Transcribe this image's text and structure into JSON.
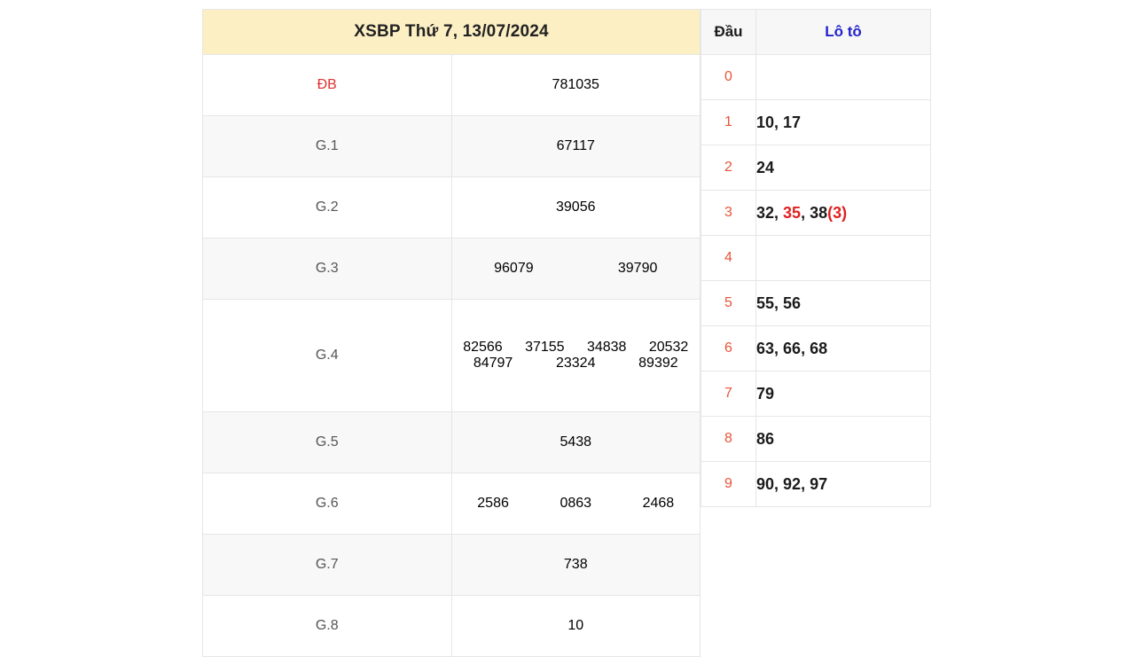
{
  "prize_table": {
    "title": "XSBP Thứ 7, 13/07/2024",
    "rows": [
      {
        "label": "ĐB",
        "special": true,
        "lines": [
          [
            "781035"
          ]
        ]
      },
      {
        "label": "G.1",
        "special": false,
        "lines": [
          [
            "67117"
          ]
        ]
      },
      {
        "label": "G.2",
        "special": false,
        "lines": [
          [
            "39056"
          ]
        ]
      },
      {
        "label": "G.3",
        "special": false,
        "lines": [
          [
            "96079",
            "39790"
          ]
        ]
      },
      {
        "label": "G.4",
        "special": false,
        "lines": [
          [
            "82566",
            "37155",
            "34838",
            "20532"
          ],
          [
            "84797",
            "23324",
            "89392"
          ]
        ]
      },
      {
        "label": "G.5",
        "special": false,
        "lines": [
          [
            "5438"
          ]
        ]
      },
      {
        "label": "G.6",
        "special": false,
        "lines": [
          [
            "2586",
            "0863",
            "2468"
          ]
        ]
      },
      {
        "label": "G.7",
        "special": false,
        "lines": [
          [
            "738"
          ]
        ]
      },
      {
        "label": "G.8",
        "special": false,
        "lines": [
          [
            "10"
          ]
        ]
      }
    ]
  },
  "loto_table": {
    "header": {
      "dau": "Đầu",
      "loto": "Lô tô"
    },
    "rows": [
      {
        "dau": "0",
        "numbers": []
      },
      {
        "dau": "1",
        "numbers": [
          {
            "text": "10",
            "highlight": false
          },
          {
            "text": "17",
            "highlight": false
          }
        ]
      },
      {
        "dau": "2",
        "numbers": [
          {
            "text": "24",
            "highlight": false
          }
        ]
      },
      {
        "dau": "3",
        "numbers": [
          {
            "text": "32",
            "highlight": false
          },
          {
            "text": "35",
            "highlight": true
          },
          {
            "text": "38(3)",
            "highlight": false,
            "suffix_highlight": "(3)"
          }
        ]
      },
      {
        "dau": "4",
        "numbers": []
      },
      {
        "dau": "5",
        "numbers": [
          {
            "text": "55",
            "highlight": false
          },
          {
            "text": "56",
            "highlight": false
          }
        ]
      },
      {
        "dau": "6",
        "numbers": [
          {
            "text": "63",
            "highlight": false
          },
          {
            "text": "66",
            "highlight": false
          },
          {
            "text": "68",
            "highlight": false
          }
        ]
      },
      {
        "dau": "7",
        "numbers": [
          {
            "text": "79",
            "highlight": false
          }
        ]
      },
      {
        "dau": "8",
        "numbers": [
          {
            "text": "86",
            "highlight": false
          }
        ]
      },
      {
        "dau": "9",
        "numbers": [
          {
            "text": "90",
            "highlight": false
          },
          {
            "text": "92",
            "highlight": false
          },
          {
            "text": "97",
            "highlight": false
          }
        ]
      }
    ]
  },
  "colors": {
    "header_bg": "#fcefc4",
    "special_red": "#dc2020",
    "loto_blue": "#2323cc",
    "dau_orange": "#e8543a",
    "row_stripe": "#f8f8f8"
  }
}
